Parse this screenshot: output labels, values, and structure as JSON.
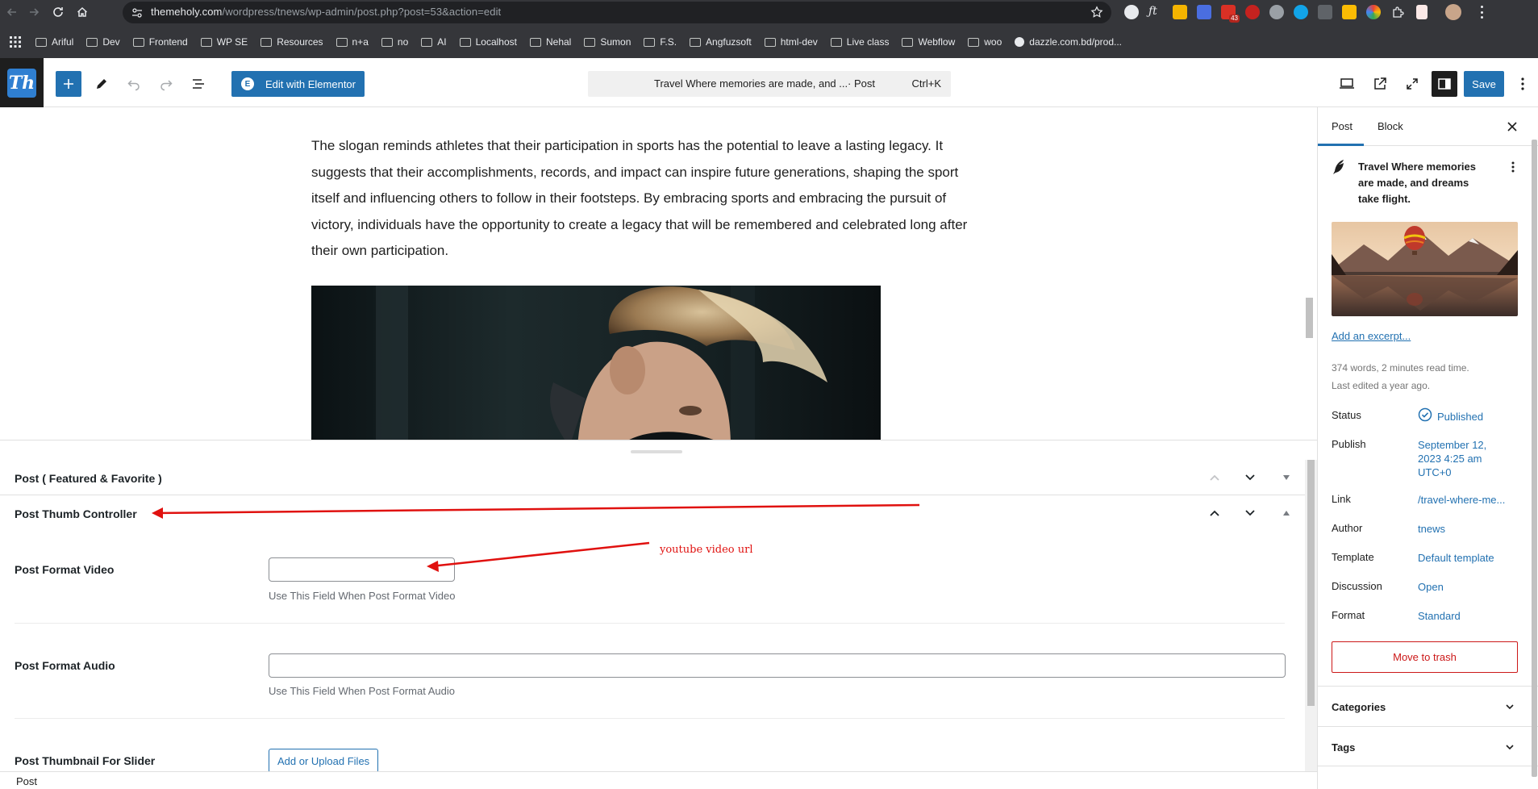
{
  "browser": {
    "url_host": "themeholy.com",
    "url_path": "/wordpress/tnews/wp-admin/post.php?post=53&action=edit",
    "extension_badge": "43",
    "bookmarks": [
      "Ariful",
      "Dev",
      "Frontend",
      "WP SE",
      "Resources",
      "n+a",
      "no",
      "AI",
      "Localhost",
      "Nehal",
      "Sumon",
      "F.S.",
      "Angfuzsoft",
      "html-dev",
      "Live class",
      "Webflow",
      "woo",
      "dazzle.com.bd/prod..."
    ]
  },
  "header": {
    "logo_text": "Th",
    "elementor_label": "Edit with Elementor",
    "elementor_icon_letter": "E",
    "command_title": "Travel Where memories are made, and ...",
    "command_kind": "· Post",
    "command_shortcut": "Ctrl+K",
    "save_label": "Save"
  },
  "content": {
    "paragraph": "The slogan reminds athletes that their participation in sports has the potential to leave a lasting legacy. It suggests that their accomplishments, records, and impact can inspire future generations, shaping the sport itself and influencing others to follow in their footsteps. By embracing sports and embracing the pursuit of victory, individuals have the opportunity to create a legacy that will be remembered and celebrated long after their own participation."
  },
  "metaboxes": {
    "featured_title": "Post ( Featured & Favorite )",
    "thumb_title": "Post Thumb Controller",
    "fields": [
      {
        "label": "Post Format Video",
        "value": "",
        "help": "Use This Field When Post Format Video"
      },
      {
        "label": "Post Format Audio",
        "value": "",
        "help": "Use This Field When Post Format Audio"
      },
      {
        "label": "Post Thumbnail For Slider",
        "button": "Add or Upload Files"
      }
    ],
    "annotation": "youtube video url"
  },
  "footer": {
    "breadcrumb": "Post"
  },
  "sidebar": {
    "tabs": [
      "Post",
      "Block"
    ],
    "post_title": "Travel Where memories are made, and dreams take flight.",
    "excerpt_link": "Add an excerpt...",
    "stats_line1": "374 words, 2 minutes read time.",
    "stats_line2": "Last edited a year ago.",
    "rows": [
      {
        "label": "Status",
        "value": "Published"
      },
      {
        "label": "Publish",
        "value_lines": [
          "September 12,",
          "2023 4:25 am",
          "UTC+0"
        ]
      },
      {
        "label": "Link",
        "value": "/travel-where-me..."
      },
      {
        "label": "Author",
        "value": "tnews"
      },
      {
        "label": "Template",
        "value": "Default template"
      },
      {
        "label": "Discussion",
        "value": "Open"
      },
      {
        "label": "Format",
        "value": "Standard"
      }
    ],
    "trash_label": "Move to trash",
    "panels": [
      "Categories",
      "Tags"
    ]
  },
  "colors": {
    "accent": "#2271b1",
    "danger": "#cc1818",
    "annotation": "#e0110f",
    "chrome": "#35363a"
  }
}
